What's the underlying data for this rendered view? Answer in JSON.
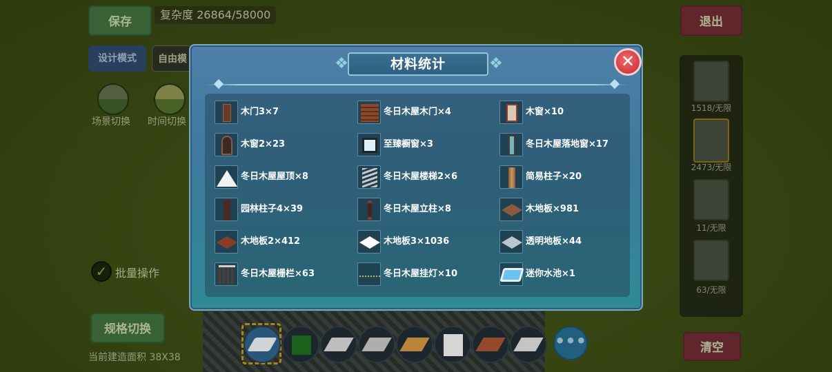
{
  "top_bar": {
    "save_label": "保存",
    "complexity": "复杂度 26864/58000",
    "exit_label": "退出"
  },
  "mode_bar": {
    "design_label": "设计模式",
    "free_label": "自由模"
  },
  "side_tools": {
    "scene_label": "场景切换",
    "time_label": "时间切换",
    "batch_label": "批量操作",
    "spec_label": "规格切换",
    "area_text": "当前建造面积 38X38",
    "clear_label": "清空"
  },
  "inventory": {
    "counts": [
      "1518/无限",
      "2473/无限",
      "11/无限",
      "63/无限"
    ]
  },
  "hotbar": {
    "more_label": "•••"
  },
  "modal": {
    "title": "材料统计",
    "close_label": "✕",
    "materials": [
      {
        "label": "木门3×7",
        "icon": "door-icon"
      },
      {
        "label": "冬日木屋木门×4",
        "icon": "cabin-door-icon"
      },
      {
        "label": "木窗×10",
        "icon": "window-icon"
      },
      {
        "label": "木窗2×23",
        "icon": "arch-window-icon"
      },
      {
        "label": "至臻橱窗×3",
        "icon": "glass-window-icon"
      },
      {
        "label": "冬日木屋落地窗×17",
        "icon": "tall-window-icon"
      },
      {
        "label": "冬日木屋屋顶×8",
        "icon": "roof-icon"
      },
      {
        "label": "冬日木屋楼梯2×6",
        "icon": "stairs-icon"
      },
      {
        "label": "简易柱子×20",
        "icon": "pillar-icon"
      },
      {
        "label": "园林柱子4×39",
        "icon": "garden-pillar-icon"
      },
      {
        "label": "冬日木屋立柱×8",
        "icon": "post-icon"
      },
      {
        "label": "木地板×981",
        "icon": "floor-icon"
      },
      {
        "label": "木地板2×412",
        "icon": "floor2-icon"
      },
      {
        "label": "木地板3×1036",
        "icon": "white-floor-icon"
      },
      {
        "label": "透明地板×44",
        "icon": "glass-floor-icon"
      },
      {
        "label": "冬日木屋栅栏×63",
        "icon": "fence-icon"
      },
      {
        "label": "冬日木屋挂灯×10",
        "icon": "string-lights-icon"
      },
      {
        "label": "迷你水池×1",
        "icon": "pool-icon"
      }
    ]
  }
}
